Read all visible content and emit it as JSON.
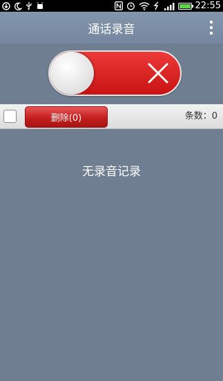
{
  "status_bar": {
    "time": "22:55",
    "icons": [
      "download-icon",
      "moon-icon",
      "usb-icon",
      "android-debug-icon",
      "nfc-icon",
      "alarm-icon",
      "wifi-icon",
      "no-data-icon",
      "signal-icon",
      "battery-icon"
    ]
  },
  "title_bar": {
    "title": "通话录音"
  },
  "toggle": {
    "state": "off"
  },
  "toolbar": {
    "delete_label": "删除(0)",
    "count_label": "条数：0"
  },
  "content": {
    "empty_message": "无录音记录"
  },
  "colors": {
    "background": "#6f7f91",
    "title_bar": "#7f91a7",
    "toggle_red": "#dd2a2a"
  }
}
